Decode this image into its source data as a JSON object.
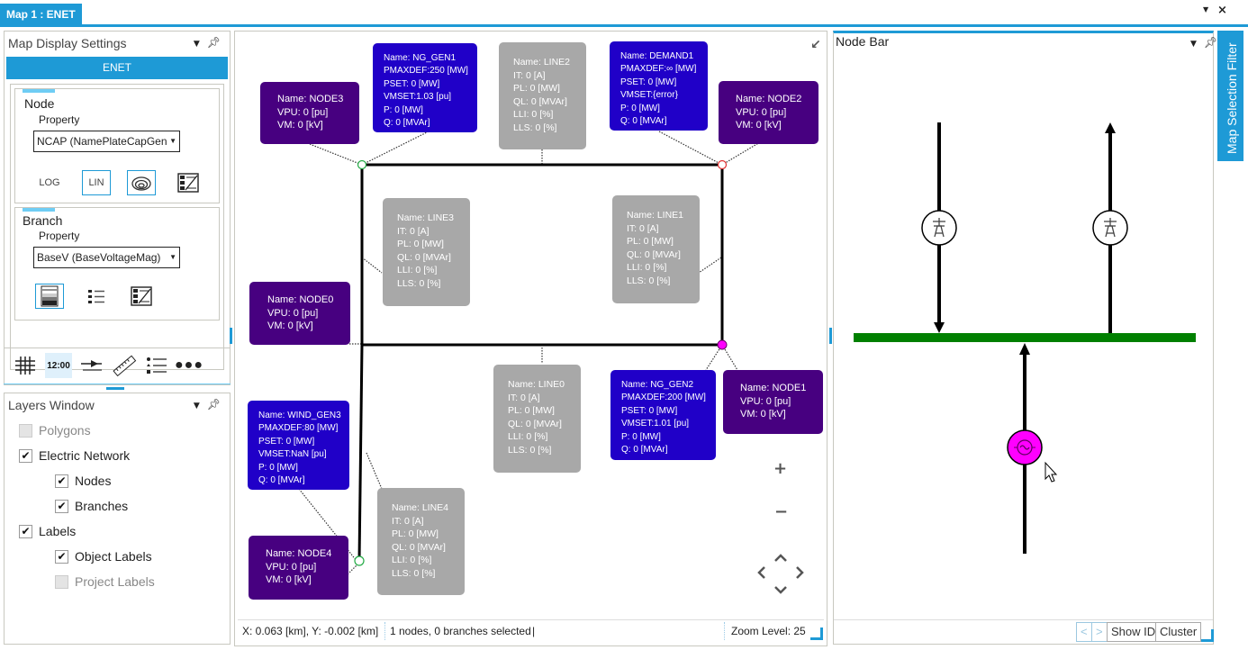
{
  "document_tab": {
    "title": "Map 1 : ENET",
    "menu_icon": "dropdown-arrow",
    "close_icon": "close"
  },
  "map_display_settings": {
    "title": "Map Display Settings",
    "network_name": "ENET",
    "node": {
      "title": "Node",
      "property_label": "Property",
      "property_value": "NCAP (NamePlateCapGen",
      "buttons": [
        "LOG",
        "LIN",
        "contour-rings",
        "legend-gradient"
      ]
    },
    "branch": {
      "title": "Branch",
      "property_label": "Property",
      "property_value": "BaseV (BaseVoltageMag)",
      "buttons": [
        "color-bands",
        "list-legend",
        "legend-gradient"
      ]
    }
  },
  "toolbar": {
    "items": [
      "grid",
      "12:00",
      "arrow-line",
      "ruler",
      "list",
      "more"
    ],
    "time_label": "12:00"
  },
  "layers_window": {
    "title": "Layers Window",
    "items": [
      {
        "label": "Polygons",
        "checked": false,
        "enabled": false,
        "level": 0
      },
      {
        "label": "Electric Network",
        "checked": true,
        "enabled": true,
        "level": 0
      },
      {
        "label": "Nodes",
        "checked": true,
        "enabled": true,
        "level": 1
      },
      {
        "label": "Branches",
        "checked": true,
        "enabled": true,
        "level": 1
      },
      {
        "label": "Labels",
        "checked": true,
        "enabled": true,
        "level": 0
      },
      {
        "label": "Object Labels",
        "checked": true,
        "enabled": true,
        "level": 1
      },
      {
        "label": "Project Labels",
        "checked": false,
        "enabled": false,
        "level": 1
      }
    ]
  },
  "map": {
    "labels": {
      "node3": [
        "Name: NODE3",
        "VPU: 0 [pu]",
        "VM: 0 [kV]"
      ],
      "ng_gen1": [
        "Name: NG_GEN1",
        "PMAXDEF:250 [MW]",
        "PSET: 0 [MW]",
        "VMSET:1.03 [pu]",
        "P: 0 [MW]",
        "Q: 0 [MVAr]"
      ],
      "line2": [
        "Name: LINE2",
        "IT: 0 [A]",
        "PL: 0 [MW]",
        "QL: 0 [MVAr]",
        "LLI: 0 [%]",
        "LLS: 0 [%]"
      ],
      "demand1": [
        "Name: DEMAND1",
        "PMAXDEF:∞ [MW]",
        "PSET: 0 [MW]",
        "VMSET:{error}",
        "P: 0 [MW]",
        "Q: 0 [MVAr]"
      ],
      "node2": [
        "Name: NODE2",
        "VPU: 0 [pu]",
        "VM: 0 [kV]"
      ],
      "line3": [
        "Name: LINE3",
        "IT: 0 [A]",
        "PL: 0 [MW]",
        "QL: 0 [MVAr]",
        "LLI: 0 [%]",
        "LLS: 0 [%]"
      ],
      "line1": [
        "Name: LINE1",
        "IT: 0 [A]",
        "PL: 0 [MW]",
        "QL: 0 [MVAr]",
        "LLI: 0 [%]",
        "LLS: 0 [%]"
      ],
      "node0": [
        "Name: NODE0",
        "VPU: 0 [pu]",
        "VM: 0 [kV]"
      ],
      "line0": [
        "Name: LINE0",
        "IT: 0 [A]",
        "PL: 0 [MW]",
        "QL: 0 [MVAr]",
        "LLI: 0 [%]",
        "LLS: 0 [%]"
      ],
      "ng_gen2": [
        "Name: NG_GEN2",
        "PMAXDEF:200 [MW]",
        "PSET: 0 [MW]",
        "VMSET:1.01 [pu]",
        "P: 0 [MW]",
        "Q: 0 [MVAr]"
      ],
      "node1": [
        "Name: NODE1",
        "VPU: 0 [pu]",
        "VM: 0 [kV]"
      ],
      "wind_gen3": [
        "Name: WIND_GEN3",
        "PMAXDEF:80 [MW]",
        "PSET: 0 [MW]",
        "VMSET:NaN [pu]",
        "P: 0 [MW]",
        "Q: 0 [MVAr]"
      ],
      "node4": [
        "Name: NODE4",
        "VPU: 0 [pu]",
        "VM: 0 [kV]"
      ],
      "line4": [
        "Name: LINE4",
        "IT: 0 [A]",
        "PL: 0 [MW]",
        "QL: 0 [MVAr]",
        "LLI: 0 [%]",
        "LLS: 0 [%]"
      ]
    },
    "colors": {
      "node_label": "#470080",
      "gen_label": "#2000c8",
      "line_label": "#a8a8a8",
      "selected_node": "#ff00ff",
      "node3_marker": "#22aa44",
      "node2_marker": "#e03030",
      "node4_marker": "#22aa44"
    },
    "zoom_in": "+",
    "zoom_out": "−",
    "status": {
      "coords": "X: 0.063 [km], Y: -0.002 [km]",
      "selection": "1 nodes, 0 branches selected",
      "cursor": "|",
      "zoom_level": "Zoom Level: 25"
    }
  },
  "node_bar": {
    "title": "Node Bar",
    "bus_color": "#008000",
    "generator_color": "#ff00ff",
    "buttons": {
      "prev": "<",
      "next": ">",
      "show_id": "Show ID",
      "cluster": "Cluster"
    }
  },
  "side_tab": {
    "label": "Map Selection Filter"
  }
}
